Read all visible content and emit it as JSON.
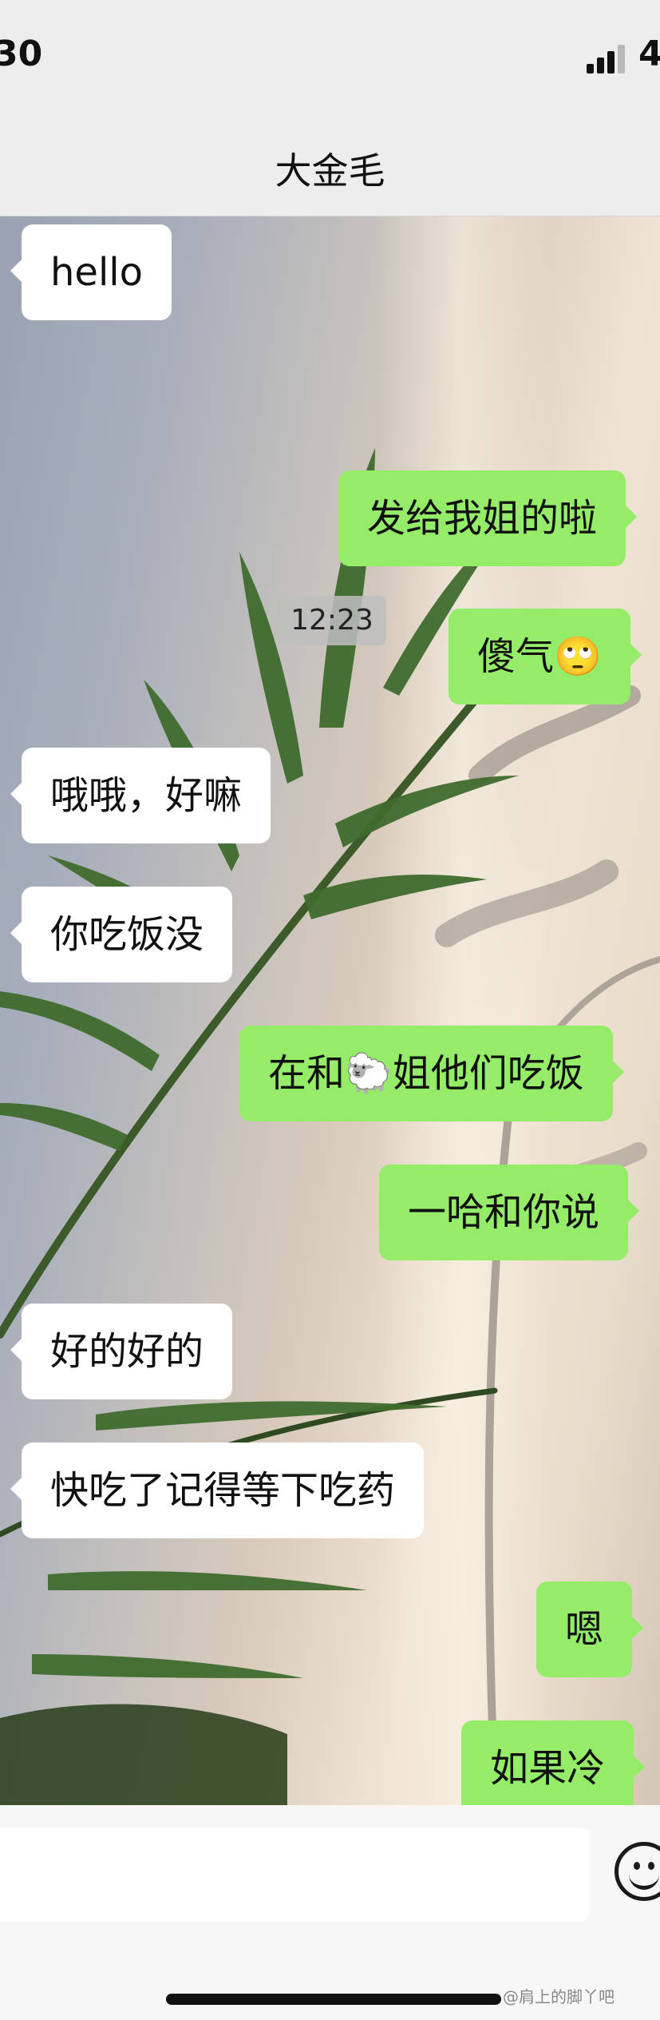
{
  "status_bar": {
    "time": "30",
    "battery": "4"
  },
  "nav": {
    "title": "大金毛"
  },
  "chat": {
    "timestamp": "12:23",
    "messages": [
      {
        "side": "left",
        "text": "hello"
      },
      {
        "side": "right",
        "text": "发给我姐的啦"
      },
      {
        "side": "right",
        "text": "傻气🙄"
      },
      {
        "side": "left",
        "text": "哦哦，好嘛"
      },
      {
        "side": "left",
        "text": "你吃饭没"
      },
      {
        "side": "right",
        "text": "在和🐑姐他们吃饭"
      },
      {
        "side": "right",
        "text": "一哈和你说"
      },
      {
        "side": "left",
        "text": "好的好的"
      },
      {
        "side": "left",
        "text": "快吃了记得等下吃药"
      },
      {
        "side": "right",
        "text": "嗯"
      },
      {
        "side": "right",
        "text": "如果冷"
      }
    ]
  },
  "input": {
    "emoji_icon": "emoji-face-icon"
  },
  "watermark": "@肩上的脚丫吧",
  "colors": {
    "my_bubble": "#95ec69",
    "their_bubble": "#ffffff",
    "bar": "#ededed"
  }
}
